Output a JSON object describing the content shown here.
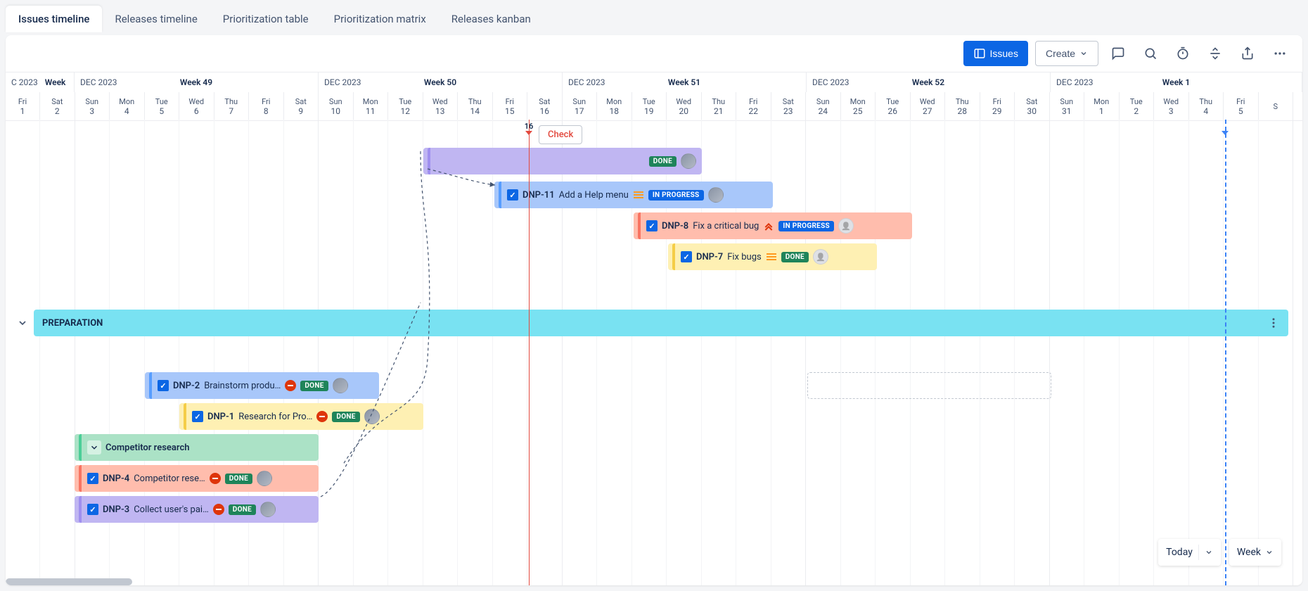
{
  "tabs": [
    "Issues timeline",
    "Releases timeline",
    "Prioritization table",
    "Prioritization matrix",
    "Releases kanban"
  ],
  "active_tab": 0,
  "toolbar": {
    "issues_btn": "Issues",
    "create_btn": "Create"
  },
  "timeline": {
    "weeks": [
      {
        "month": "C 2023",
        "label": "Week"
      },
      {
        "month": "DEC 2023",
        "label": "Week 49"
      },
      {
        "month": "DEC 2023",
        "label": "Week 50"
      },
      {
        "month": "DEC 2023",
        "label": "Week 51"
      },
      {
        "month": "DEC 2023",
        "label": "Week 52"
      },
      {
        "month": "DEC 2023",
        "label": "Week 1"
      }
    ],
    "days": [
      {
        "w": "Fri",
        "d": "1"
      },
      {
        "w": "Sat",
        "d": "2"
      },
      {
        "w": "Sun",
        "d": "3"
      },
      {
        "w": "Mon",
        "d": "4"
      },
      {
        "w": "Tue",
        "d": "5"
      },
      {
        "w": "Wed",
        "d": "6"
      },
      {
        "w": "Thu",
        "d": "7"
      },
      {
        "w": "Fri",
        "d": "8"
      },
      {
        "w": "Sat",
        "d": "9"
      },
      {
        "w": "Sun",
        "d": "10"
      },
      {
        "w": "Mon",
        "d": "11"
      },
      {
        "w": "Tue",
        "d": "12"
      },
      {
        "w": "Wed",
        "d": "13"
      },
      {
        "w": "Thu",
        "d": "14"
      },
      {
        "w": "Fri",
        "d": "15"
      },
      {
        "w": "Sat",
        "d": "16"
      },
      {
        "w": "Sun",
        "d": "17"
      },
      {
        "w": "Mon",
        "d": "18"
      },
      {
        "w": "Tue",
        "d": "19"
      },
      {
        "w": "Wed",
        "d": "20"
      },
      {
        "w": "Thu",
        "d": "21"
      },
      {
        "w": "Fri",
        "d": "22"
      },
      {
        "w": "Sat",
        "d": "23"
      },
      {
        "w": "Sun",
        "d": "24"
      },
      {
        "w": "Mon",
        "d": "25"
      },
      {
        "w": "Tue",
        "d": "26"
      },
      {
        "w": "Wed",
        "d": "27"
      },
      {
        "w": "Thu",
        "d": "28"
      },
      {
        "w": "Fri",
        "d": "29"
      },
      {
        "w": "Sat",
        "d": "30"
      },
      {
        "w": "Sun",
        "d": "31"
      },
      {
        "w": "Mon",
        "d": "1"
      },
      {
        "w": "Tue",
        "d": "2"
      },
      {
        "w": "Wed",
        "d": "3"
      },
      {
        "w": "Thu",
        "d": "4"
      },
      {
        "w": "Fri",
        "d": "5"
      },
      {
        "w": "S",
        "d": ""
      }
    ],
    "now_label": "16",
    "check_label": "Check"
  },
  "lane": {
    "title": "PREPARATION"
  },
  "group": {
    "title": "Competitor research"
  },
  "issues": {
    "dnp11": {
      "key": "DNP-11",
      "title": "Add a Help menu",
      "status": "IN PROGRESS"
    },
    "dnp8": {
      "key": "DNP-8",
      "title": "Fix a critical bug",
      "status": "IN PROGRESS"
    },
    "dnp7": {
      "key": "DNP-7",
      "title": "Fix bugs",
      "status": "DONE"
    },
    "dnp2": {
      "key": "DNP-2",
      "title": "Brainstorm produ…",
      "status": "DONE"
    },
    "dnp1": {
      "key": "DNP-1",
      "title": "Research for Pro…",
      "status": "DONE"
    },
    "dnp4": {
      "key": "DNP-4",
      "title": "Competitor rese…",
      "status": "DONE"
    },
    "dnp3": {
      "key": "DNP-3",
      "title": "Collect user's pai…",
      "status": "DONE"
    }
  },
  "float": {
    "today": "Today",
    "scale": "Week"
  }
}
